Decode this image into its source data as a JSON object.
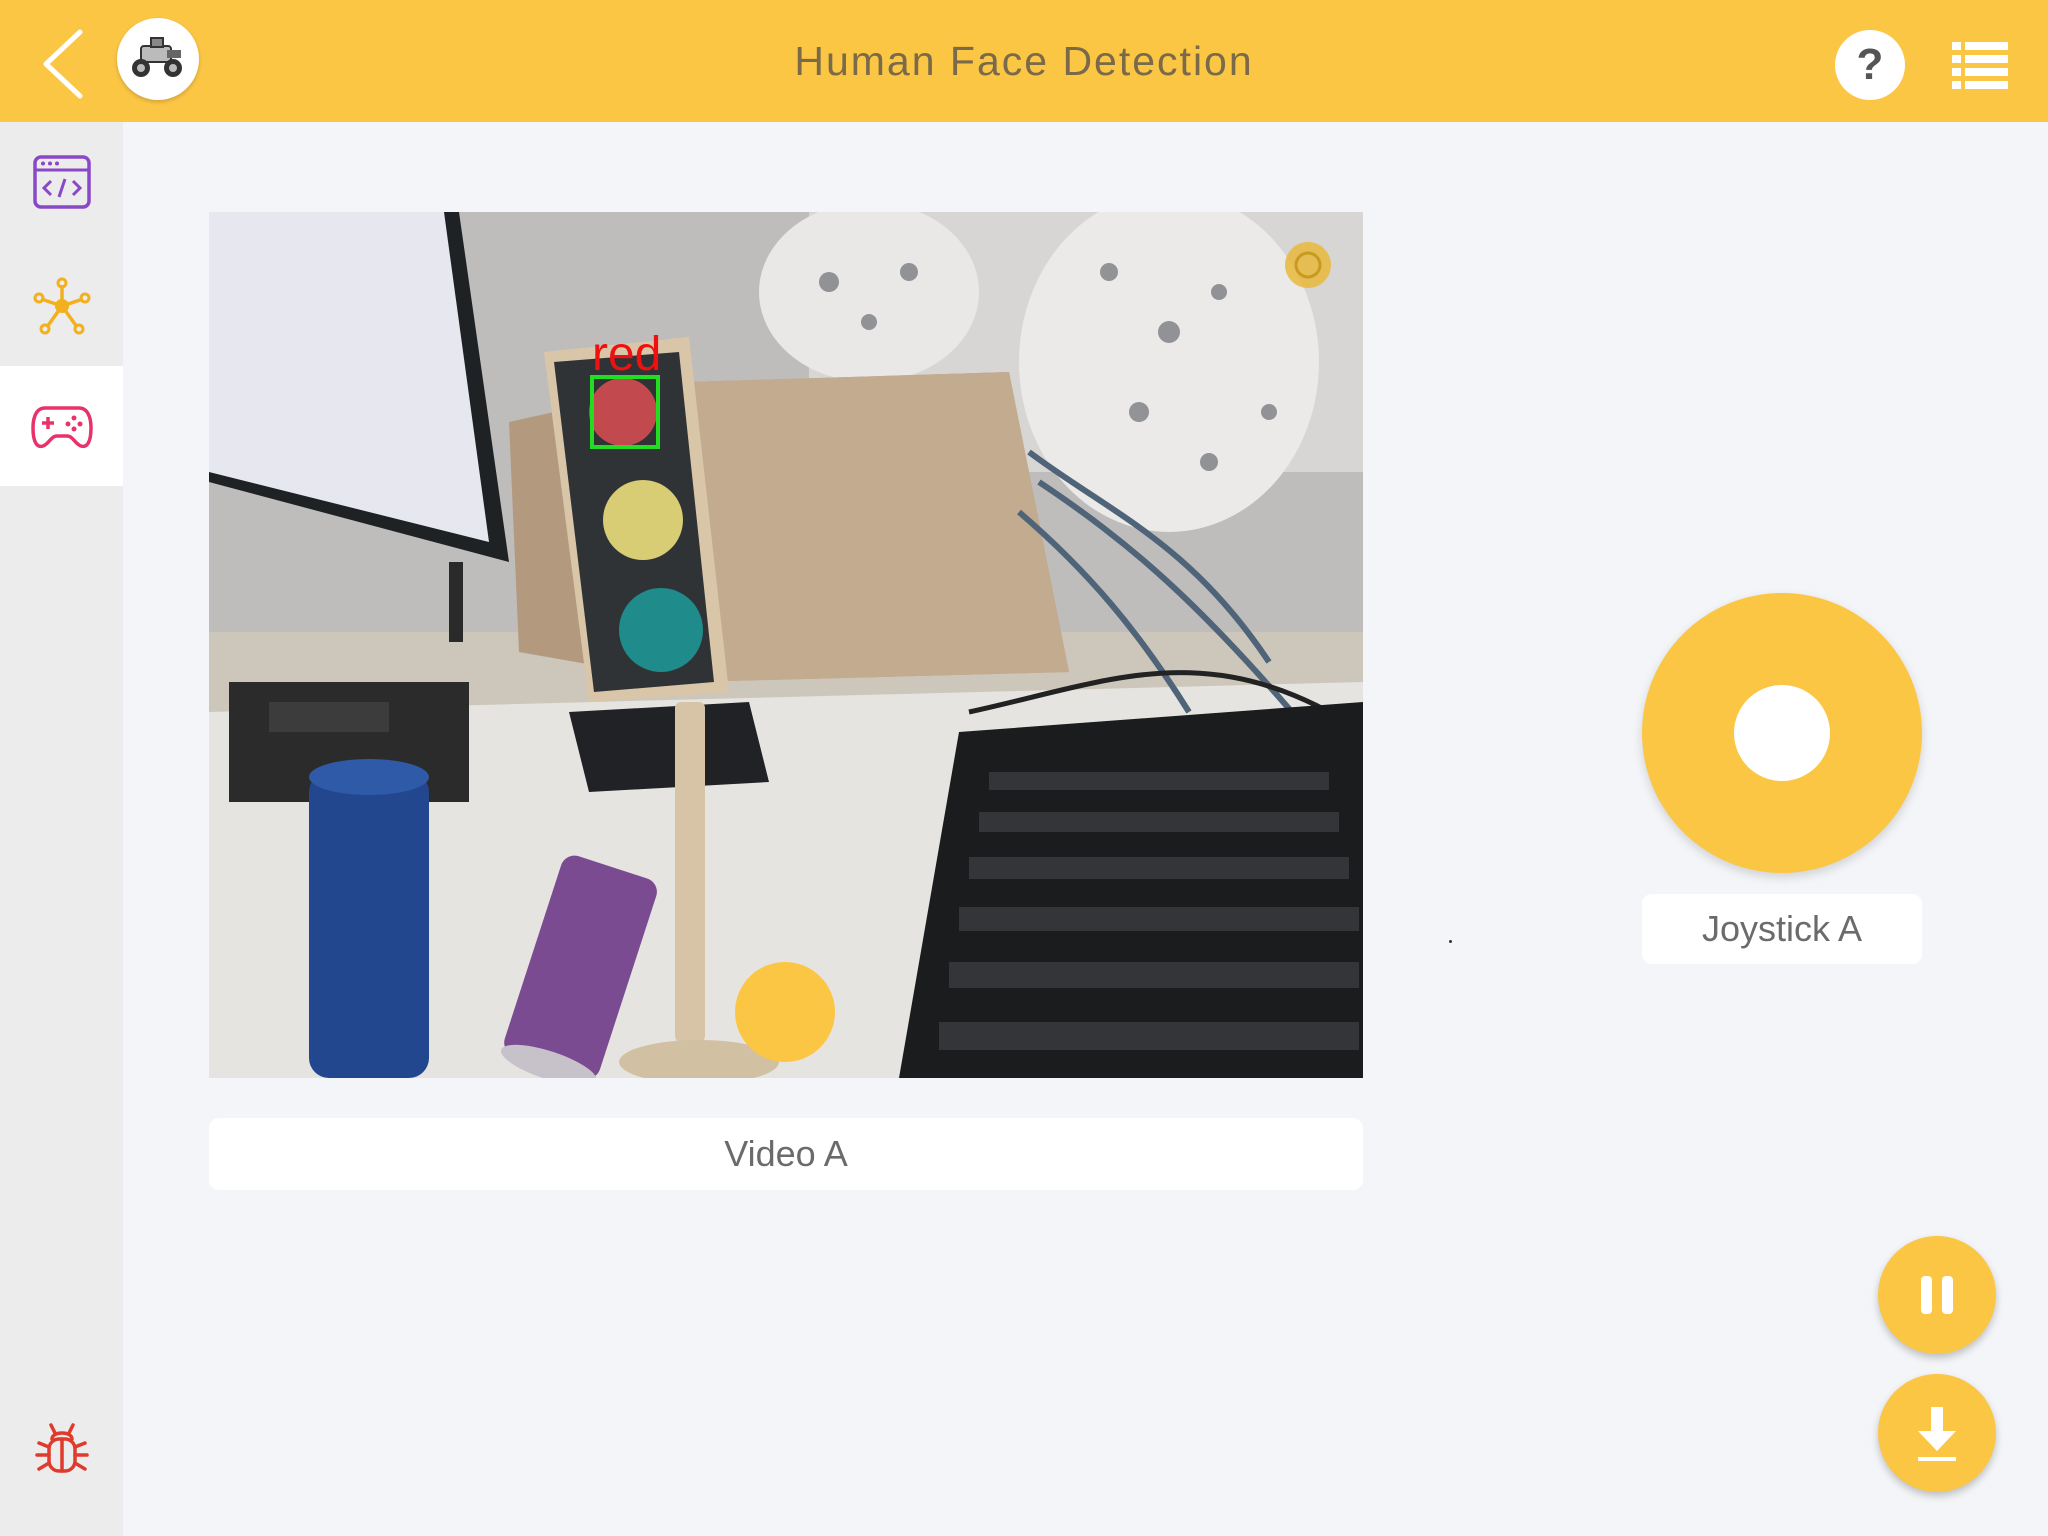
{
  "header": {
    "title": "Human Face Detection",
    "back_icon": "chevron-left-icon",
    "avatar_icon": "robot-car-icon",
    "help_label": "?",
    "menu_icon": "list-icon",
    "accent_color": "#fcc645"
  },
  "sidebar": {
    "items": [
      {
        "icon": "code-window-icon",
        "color": "#8a48c8"
      },
      {
        "icon": "hub-node-icon",
        "color": "#f2b01e"
      },
      {
        "icon": "gamepad-icon",
        "color": "#e8336a",
        "active": true
      },
      {
        "icon": "bug-icon",
        "color": "#e03a2c"
      }
    ]
  },
  "video_widget": {
    "label": "Video A",
    "detection_text": "red",
    "detection_box_color": "#22dd22",
    "detection_text_color": "#ee1111"
  },
  "joystick_widget": {
    "label": "Joystick A"
  },
  "actions": {
    "pause_icon": "pause-icon",
    "download_icon": "download-icon"
  }
}
